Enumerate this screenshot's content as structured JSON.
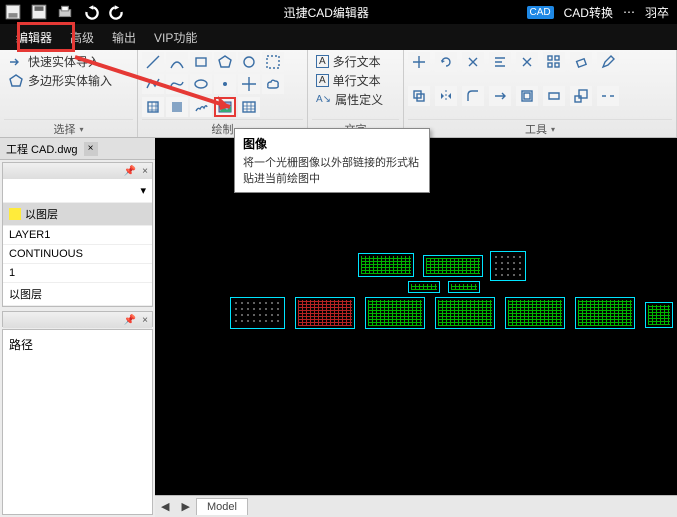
{
  "titlebar": {
    "title": "迅捷CAD编辑器",
    "convert_label": "CAD转换",
    "user": "羽卒"
  },
  "tabs": {
    "editor": "编辑器",
    "advanced": "高级",
    "output": "输出",
    "vip": "VIP功能"
  },
  "ribbon": {
    "select_group": "选择",
    "quick_import": "快速实体导入",
    "poly_input": "多边形实体输入",
    "draw_group": "绘制",
    "text_group_multi": "多行文本",
    "text_group_single": "单行文本",
    "text_group_attr": "属性定义",
    "text_label": "文字",
    "tools_label": "工具"
  },
  "tooltip": {
    "title": "图像",
    "body": "将一个光栅图像以外部链接的形式粘贴进当前绘图中"
  },
  "file": {
    "name": "工程 CAD.dwg"
  },
  "layers": {
    "items": [
      {
        "label": "以图层",
        "color": "#ffeb3b",
        "sel": true
      },
      {
        "label": "LAYER1"
      },
      {
        "label": "CONTINUOUS"
      },
      {
        "label": "1"
      },
      {
        "label": "以图层"
      }
    ]
  },
  "panel2": {
    "path_label": "路径"
  },
  "status": {
    "model": "Model"
  }
}
